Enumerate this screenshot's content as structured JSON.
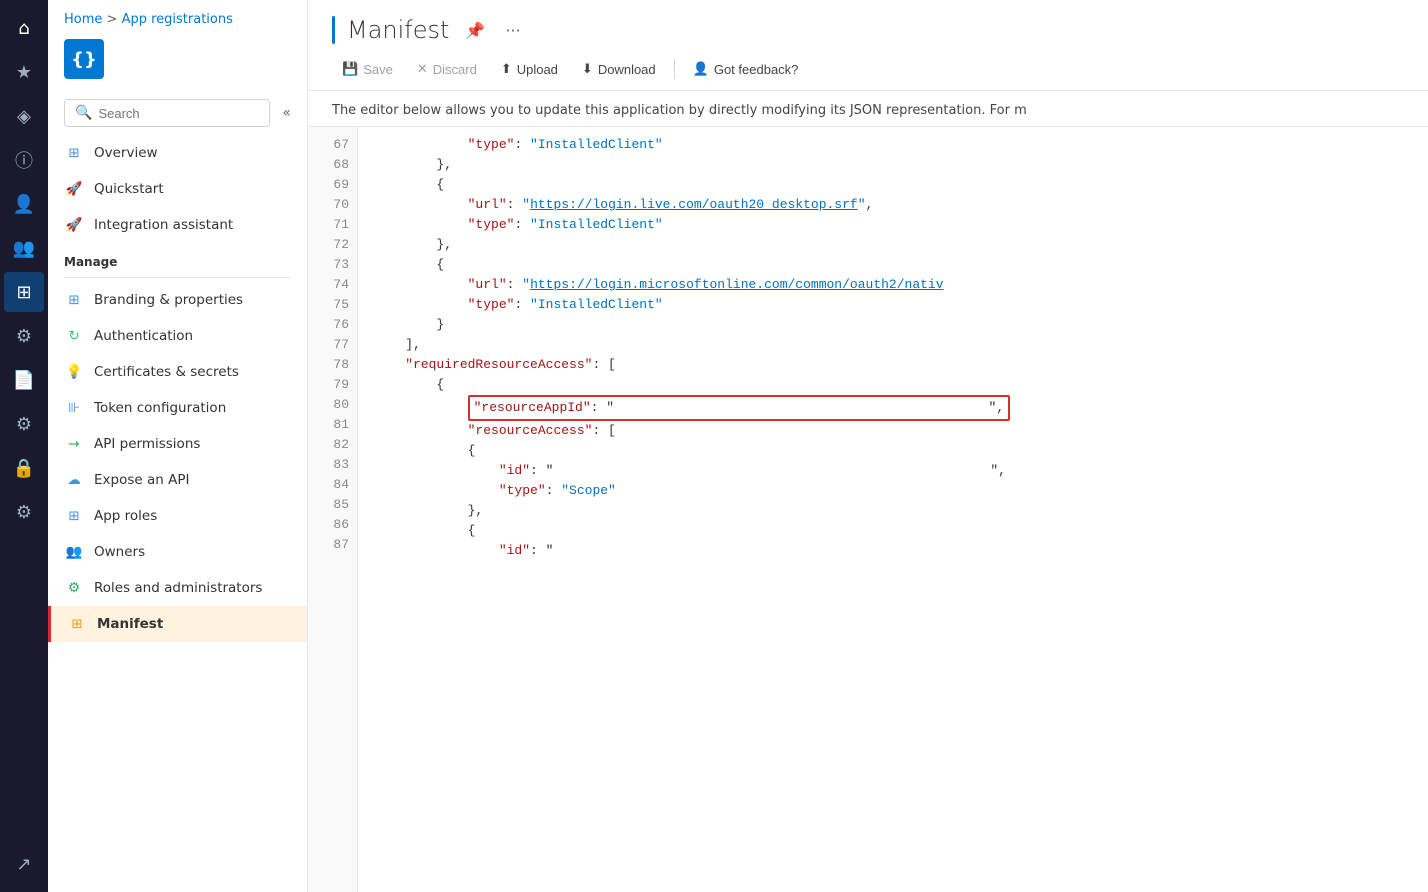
{
  "breadcrumb": {
    "home": "Home",
    "separator": ">",
    "section": "App registrations"
  },
  "app_icon": "{}",
  "search": {
    "placeholder": "Search",
    "collapse_label": "«"
  },
  "nav": {
    "overview_label": "Overview",
    "quickstart_label": "Quickstart",
    "integration_label": "Integration assistant",
    "manage_label": "Manage",
    "branding_label": "Branding & properties",
    "auth_label": "Authentication",
    "cert_label": "Certificates & secrets",
    "token_label": "Token configuration",
    "api_label": "API permissions",
    "expose_label": "Expose an API",
    "approles_label": "App roles",
    "owners_label": "Owners",
    "rolesadmin_label": "Roles and administrators",
    "manifest_label": "Manifest"
  },
  "page": {
    "title": "Manifest",
    "description": "The editor below allows you to update this application by directly modifying its JSON representation. For m"
  },
  "toolbar": {
    "save_label": "Save",
    "discard_label": "Discard",
    "upload_label": "Upload",
    "download_label": "Download",
    "feedback_label": "Got feedback?"
  },
  "code": {
    "lines": [
      {
        "num": "67",
        "content": "            \"type\": \"InstalledClient\"",
        "type": "normal"
      },
      {
        "num": "68",
        "content": "        },",
        "type": "normal"
      },
      {
        "num": "69",
        "content": "        {",
        "type": "normal"
      },
      {
        "num": "70",
        "content": "            \"url\": \"https://login.live.com/oauth20_desktop.srf\",",
        "type": "url70"
      },
      {
        "num": "71",
        "content": "            \"type\": \"InstalledClient\"",
        "type": "normal"
      },
      {
        "num": "72",
        "content": "        },",
        "type": "normal"
      },
      {
        "num": "73",
        "content": "        {",
        "type": "normal"
      },
      {
        "num": "74",
        "content": "            \"url\": \"https://login.microsoftonline.com/common/oauth2/nativ",
        "type": "url74"
      },
      {
        "num": "75",
        "content": "            \"type\": \"InstalledClient\"",
        "type": "normal"
      },
      {
        "num": "76",
        "content": "        }",
        "type": "normal"
      },
      {
        "num": "77",
        "content": "    ],",
        "type": "normal"
      },
      {
        "num": "78",
        "content": "    \"requiredResourceAccess\": [",
        "type": "key78"
      },
      {
        "num": "79",
        "content": "        {",
        "type": "normal"
      },
      {
        "num": "80",
        "content": "            \"resourceAppId\": \"",
        "type": "highlight"
      },
      {
        "num": "81",
        "content": "            \"resourceAccess\": [",
        "type": "normal"
      },
      {
        "num": "82",
        "content": "            {",
        "type": "normal"
      },
      {
        "num": "83",
        "content": "                \"id\": \"",
        "type": "id83"
      },
      {
        "num": "84",
        "content": "                \"type\": \"Scope\"",
        "type": "normal"
      },
      {
        "num": "85",
        "content": "            },",
        "type": "normal"
      },
      {
        "num": "86",
        "content": "            {",
        "type": "normal"
      },
      {
        "num": "87",
        "content": "                \"id\": \"",
        "type": "id87"
      }
    ]
  }
}
